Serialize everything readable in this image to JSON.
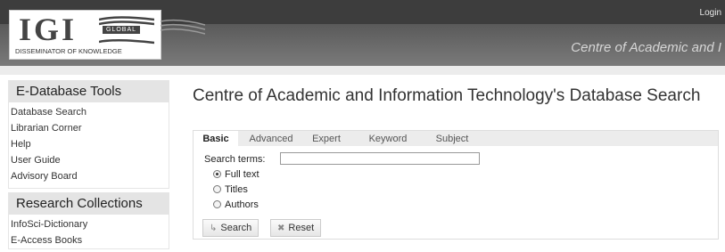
{
  "header": {
    "login_label": "Login",
    "site_title": "Centre of Academic and I",
    "logo": {
      "main": "IGI",
      "badge": "GLOBAL",
      "tagline": "DISSEMINATOR OF KNOWLEDGE"
    }
  },
  "sidebar": {
    "tools": {
      "heading": "E-Database Tools",
      "items": [
        "Database Search",
        "Librarian Corner",
        "Help",
        "User Guide",
        "Advisory Board"
      ]
    },
    "research": {
      "heading": "Research Collections",
      "items": [
        "InfoSci-Dictionary",
        "E-Access Books"
      ]
    }
  },
  "main": {
    "title": "Centre of Academic and Information Technology's Database Search",
    "tabs": [
      "Basic",
      "Advanced",
      "Expert",
      "Keyword",
      "Subject"
    ],
    "active_tab": "Basic",
    "search": {
      "label": "Search terms:",
      "value": "",
      "options": [
        "Full text",
        "Titles",
        "Authors"
      ],
      "selected_option": "Full text",
      "search_button": "Search",
      "reset_button": "Reset",
      "search_icon": "arrow-return-icon",
      "reset_icon": "x-icon"
    }
  }
}
